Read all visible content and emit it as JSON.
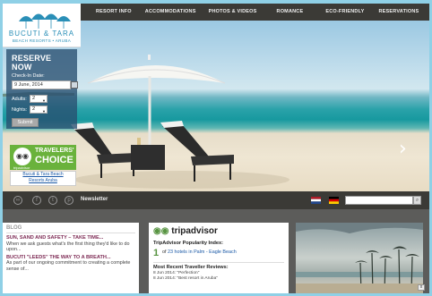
{
  "logo": {
    "name": "BUCUTI & TARA",
    "subtitle": "BEACH RESORTS • ARUBA"
  },
  "nav": [
    {
      "label": "RESORT INFO",
      "name": "nav-resort-info"
    },
    {
      "label": "ACCOMMODATIONS",
      "name": "nav-accommodations"
    },
    {
      "label": "PHOTOS & VIDEOS",
      "name": "nav-photos-videos"
    },
    {
      "label": "ROMANCE",
      "name": "nav-romance"
    },
    {
      "label": "ECO-FRIENDLY",
      "name": "nav-eco-friendly"
    },
    {
      "label": "RESERVATIONS",
      "name": "nav-reservations"
    }
  ],
  "reserve": {
    "title": "RESERVE NOW",
    "checkin_label": "Check-In Date:",
    "checkin_value": "9 June, 2014",
    "adults_label": "Adults:",
    "adults_value": "2",
    "nights_label": "Nights:",
    "nights_value": "2",
    "submit": "Submit"
  },
  "badge": {
    "small": "tripadvisor",
    "travelers": "TRAVELERS'",
    "choice": "CHOICE",
    "caption_line1": "Bucuti & Tara Beach",
    "caption_line2": "Resorts Aruba"
  },
  "socialbar": {
    "newsletter": "Newsletter"
  },
  "blog": {
    "title": "BLOG",
    "post1_title": "SUN, SAND AND SAFETY – TAKE TIME...",
    "post1_text": "When we ask guests what's the first thing they'd like to do upon...",
    "post2_title": "BUCUTI \"LEEDS\" THE WAY TO A BREATH...",
    "post2_text": "As part of our ongoing commitment to creating a complete sense of..."
  },
  "tripadvisor": {
    "logo_text": "tripadvisor",
    "popularity_label": "TripAdvisor Popularity Index:",
    "rank": "1",
    "rank_text_pre": "of",
    "rank_link": "23 hotels in Palm - Eagle Beach",
    "reviews_label": "Most Recent Traveller Reviews:",
    "review1": "8 Jun 2014: \"Perfection\"",
    "review2": "8 Jun 2014: \"Best resort in Aruba\""
  },
  "colors": {
    "nav_bg": "#3b3a36",
    "accent_green": "#6ab23c",
    "blog_title": "#7e2b55",
    "link": "#1c5aa7"
  }
}
